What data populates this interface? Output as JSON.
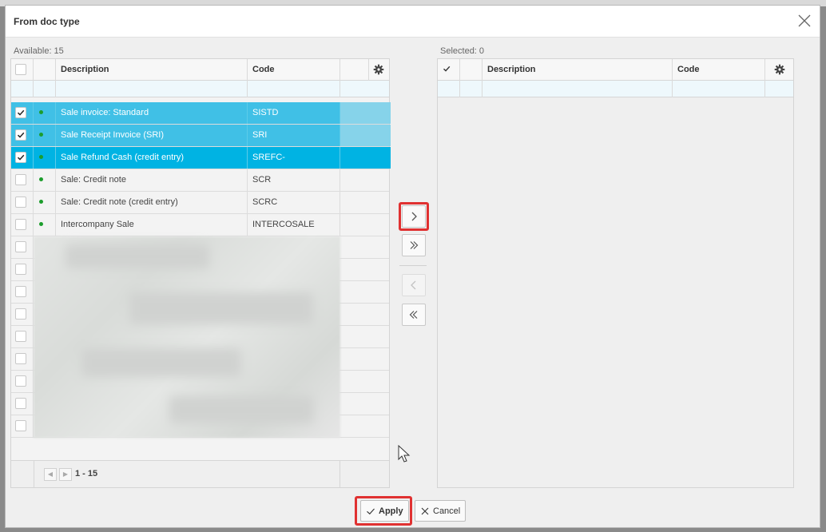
{
  "dialog": {
    "title": "From doc type",
    "close_icon": "close-icon"
  },
  "available": {
    "caption": "Available: 15",
    "columns": {
      "description": "Description",
      "code": "Code"
    },
    "rows": [
      {
        "description": "Sale invoice: Standard",
        "code": "SISTD",
        "checked": true,
        "state": "selected"
      },
      {
        "description": "Sale Receipt Invoice (SRI)",
        "code": "SRI",
        "checked": true,
        "state": "selected"
      },
      {
        "description": "Sale Refund Cash (credit entry)",
        "code": "SREFC-",
        "checked": true,
        "state": "active"
      },
      {
        "description": "Sale: Credit note",
        "code": "SCR",
        "checked": false,
        "state": "normal"
      },
      {
        "description": "Sale: Credit note (credit entry)",
        "code": "SCRC",
        "checked": false,
        "state": "normal"
      },
      {
        "description": "Intercompany Sale",
        "code": "INTERCOSALE",
        "checked": false,
        "state": "normal"
      }
    ],
    "pager": {
      "range": "1 - 15"
    }
  },
  "selected": {
    "caption": "Selected: 0",
    "columns": {
      "description": "Description",
      "code": "Code"
    }
  },
  "transfer": {
    "move_right_icon": "chevron-right-icon",
    "move_all_right_icon": "double-chevron-right-icon",
    "move_left_icon": "chevron-left-icon",
    "move_all_left_icon": "double-chevron-left-icon"
  },
  "footer": {
    "apply_label": "Apply",
    "cancel_label": "Cancel"
  },
  "colors": {
    "selected_row": "#40c0e6",
    "active_row": "#00b3e3",
    "status_dot": "#1c9d2c",
    "highlight": "#e03131"
  }
}
